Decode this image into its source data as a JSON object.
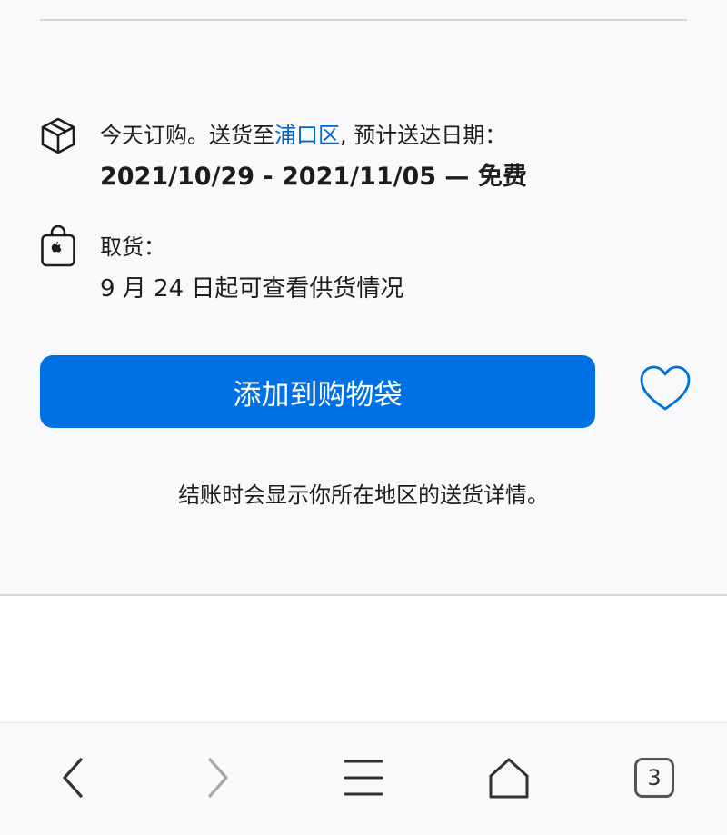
{
  "delivery": {
    "prefix": "今天订购。送货至",
    "location": "浦口区",
    "suffix": ", 预计送达日期：",
    "dates": "2021/10/29 - 2021/11/05 — 免费"
  },
  "pickup": {
    "label": "取货：",
    "availability": "9 月 24 日起可查看供货情况"
  },
  "actions": {
    "add_to_bag": "添加到购物袋",
    "favorite_icon": "heart-icon"
  },
  "note": "结账时会显示你所在地区的送货详情。",
  "toolbar": {
    "tab_count": "3",
    "icons": [
      "back-icon",
      "forward-icon",
      "menu-icon",
      "home-icon",
      "tabs-icon"
    ]
  },
  "colors": {
    "accent": "#0071e3",
    "link": "#0066cc",
    "panel_bg": "#f9f9fb"
  }
}
